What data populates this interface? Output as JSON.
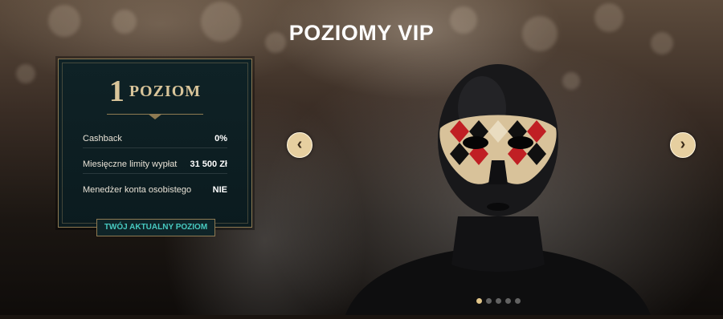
{
  "page": {
    "title": "POZIOMY VIP"
  },
  "level_card": {
    "level_number": "1",
    "level_word": "POZIOM",
    "rows": [
      {
        "label": "Cashback",
        "value": "0%"
      },
      {
        "label": "Miesięczne limity wypłat",
        "value": "31 500 Zł"
      },
      {
        "label": "Menedżer konta osobistego",
        "value": "NIE"
      }
    ],
    "current_badge": "TWÓJ AKTUALNY POZIOM"
  },
  "carousel": {
    "prev_icon": "chevron-left-icon",
    "next_icon": "chevron-right-icon",
    "prev_glyph": "‹",
    "next_glyph": "›",
    "slide_count": 5,
    "active_index": 0
  },
  "colors": {
    "accent_gold": "#d9c59a",
    "badge_teal": "#47c9c0",
    "card_bg": "#0f2226"
  }
}
